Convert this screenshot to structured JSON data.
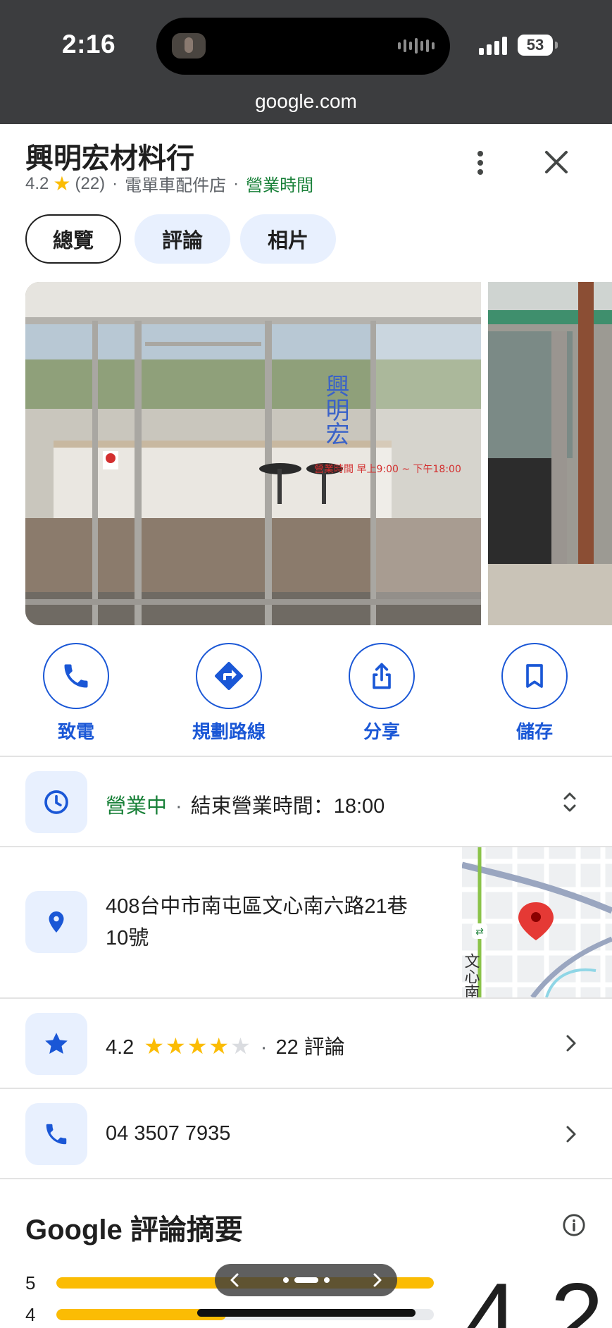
{
  "status_bar": {
    "time": "2:16",
    "battery": "53",
    "url": "google.com"
  },
  "place": {
    "name": "興明宏材料行",
    "rating": "4.2",
    "review_count": "(22)",
    "category": "電單車配件店",
    "hours_link": "營業時間"
  },
  "tabs": [
    {
      "label": "總覽",
      "active": true
    },
    {
      "label": "評論",
      "active": false
    },
    {
      "label": "相片",
      "active": false
    }
  ],
  "photo": {
    "sign_text": "興明宏",
    "door_text": "營業時間 早上9:00 ~ 下午18:00"
  },
  "actions": [
    {
      "label": "致電",
      "icon": "phone-icon"
    },
    {
      "label": "規劃路線",
      "icon": "directions-icon"
    },
    {
      "label": "分享",
      "icon": "share-icon"
    },
    {
      "label": "儲存",
      "icon": "bookmark-icon"
    }
  ],
  "hours": {
    "status": "營業中",
    "closing": "結束營業時間：18:00"
  },
  "address": {
    "line1": "408台中市南屯區文心南六路21巷",
    "line2": "10號",
    "map_label": "文心南"
  },
  "rating_row": {
    "rating": "4.2",
    "stars": 4.2,
    "reviews": "22 評論"
  },
  "phone": {
    "number": "04 3507 7935"
  },
  "review_summary": {
    "title": "Google 評論摘要",
    "overall": "4.2",
    "histogram": [
      {
        "stars": "5",
        "share": 1.0
      },
      {
        "stars": "4",
        "share": 0.45
      }
    ]
  },
  "colors": {
    "accent": "#1a57d6",
    "open_green": "#188038",
    "star": "#fbbc04",
    "status_bar": "#3c3d3f"
  }
}
